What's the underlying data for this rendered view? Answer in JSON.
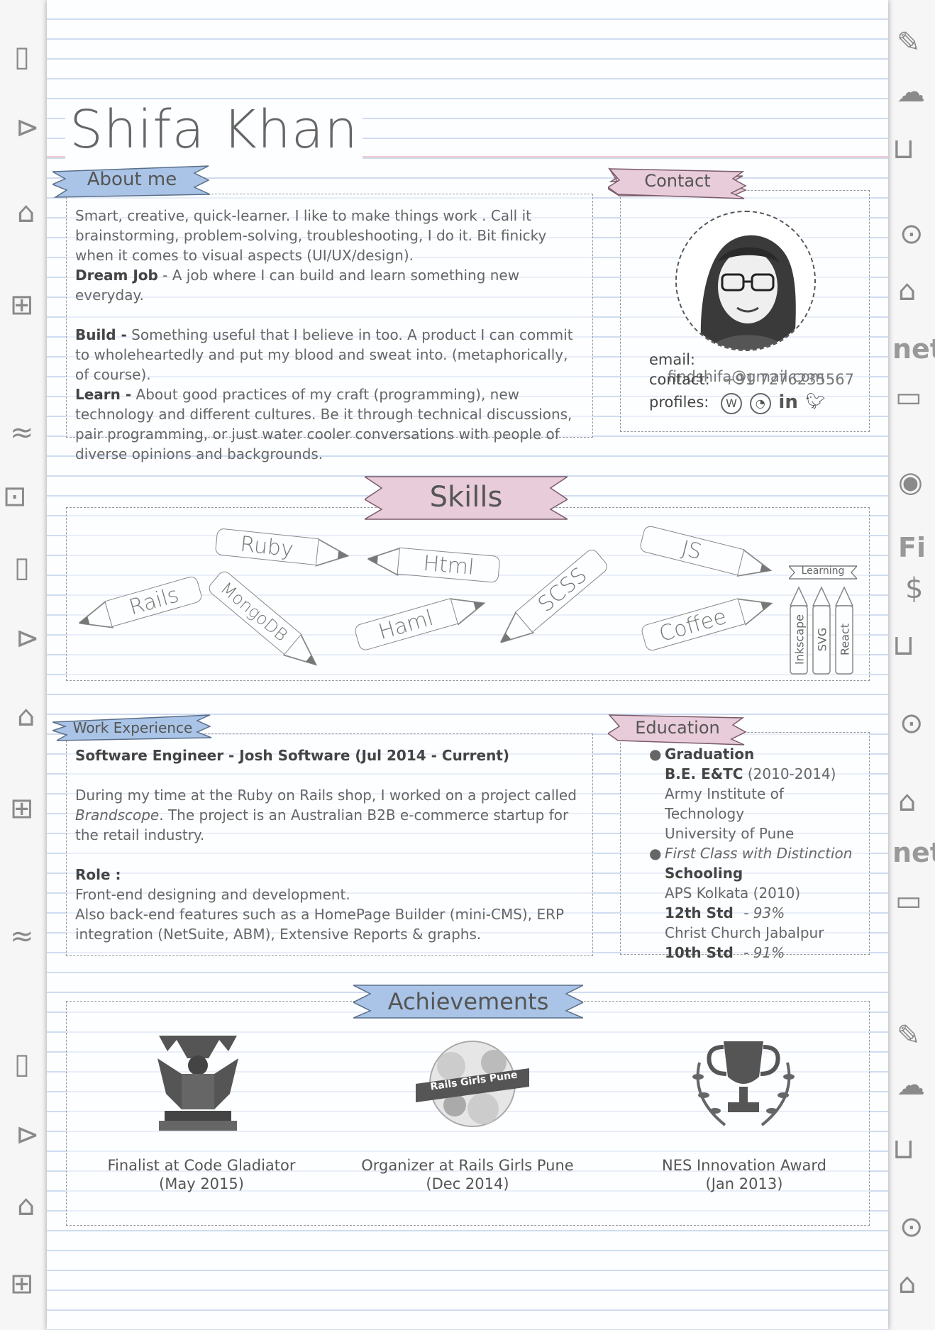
{
  "header": {
    "name": "Shifa Khan"
  },
  "about": {
    "heading": "About me",
    "intro": "Smart, creative, quick-learner. I like to make things work . Call it brainstorming, problem-solving, troubleshooting, I do it. Bit finicky when it comes to visual aspects (UI/UX/design).",
    "dream_label": "Dream Job",
    "dream_text": " - A job where I can build and learn something new everyday.",
    "build_label": "Build -",
    "build_text": " Something useful that I believe in too. A product I can commit to wholeheartedly and put my blood and sweat into. (metaphorically, of course).",
    "learn_label": "Learn -",
    "learn_text": " About good practices of my craft (programming), new technology and different cultures. Be it through technical discussions, pair programming, or just water cooler conversations with people of diverse opinions and backgrounds."
  },
  "contact": {
    "heading": "Contact",
    "email_label": "email:",
    "email": "findshifa@gmail.com",
    "phone_label": "contact:",
    "phone": "+91 7276235567",
    "profiles_label": "profiles:",
    "profile_icons": [
      "wordpress-icon",
      "github-icon",
      "linkedin-icon",
      "twitter-icon"
    ]
  },
  "skills": {
    "heading": "Skills",
    "items": [
      "Ruby",
      "Html",
      "JS",
      "Rails",
      "MongoDB",
      "Haml",
      "SCSS",
      "Coffee"
    ],
    "learning_heading": "Learning",
    "learning": [
      "Inkscape",
      "SVG",
      "React"
    ]
  },
  "work": {
    "heading": "Work Experience",
    "title": "Software Engineer - Josh Software (Jul 2014 - Current)",
    "desc_pre": "During my time at the Ruby on Rails shop, I worked on a project called ",
    "desc_em": "Brandscope",
    "desc_post": ". The project is an Australian B2B e-commerce startup for the retail industry.",
    "role_label": "Role :",
    "role_line1": "Front-end designing and development.",
    "role_line2": "Also back-end features such as a HomePage Builder (mini-CMS), ERP integration (NetSuite, ABM), Extensive Reports & graphs."
  },
  "education": {
    "heading": "Education",
    "graduation_label": "Graduation",
    "degree": "B.E. E&TC",
    "degree_years": " (2010-2014)",
    "college": "Army Institute of Technology",
    "university": "University of Pune",
    "distinction": "First Class with Distinction",
    "schooling_label": "Schooling",
    "school1": "APS Kolkata (2010)",
    "std12": "12th Std",
    "std12_score": "- 93%",
    "school2": "Christ Church Jabalpur",
    "std10": "10th Std",
    "std10_score": "- 91%"
  },
  "achievements": {
    "heading": "Achievements",
    "items": [
      {
        "line1": "Finalist at Code Gladiator",
        "line2": "(May 2015)"
      },
      {
        "line1": "Organizer at Rails Girls Pune",
        "line2": "(Dec 2014)"
      },
      {
        "line1": "NES Innovation Award",
        "line2": "(Jan 2013)"
      }
    ],
    "rails_badge_text": "Rails Girls Pune"
  },
  "colors": {
    "blue_ribbon": "#a9c4e6",
    "pink_ribbon": "#e8ccd9",
    "ink": "#555555",
    "rule_line": "#cfdcf1"
  }
}
